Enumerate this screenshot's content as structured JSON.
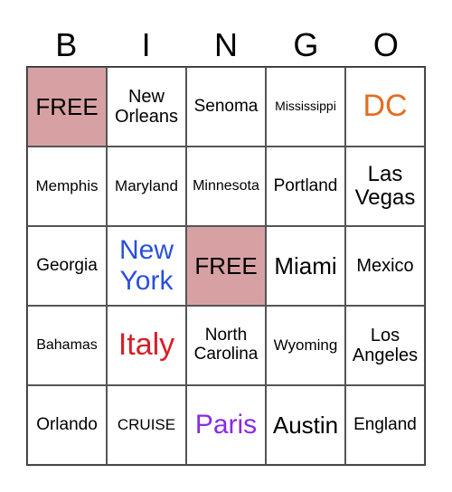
{
  "header": [
    "B",
    "I",
    "N",
    "G",
    "O"
  ],
  "colors": {
    "free_bg": "#d7a1a3",
    "orange": "#e36c1f",
    "blue": "#2b4fdc",
    "red": "#d91e26",
    "purple": "#8a2be2"
  },
  "cells": [
    [
      "FREE",
      "New Orleans",
      "Senoma",
      "Mississippi",
      "DC"
    ],
    [
      "Memphis",
      "Maryland",
      "Minnesota",
      "Portland",
      "Las Vegas"
    ],
    [
      "Georgia",
      "New York",
      "FREE",
      "Miami",
      "Mexico"
    ],
    [
      "Bahamas",
      "Italy",
      "North Carolina",
      "Wyoming",
      "Los Angeles"
    ],
    [
      "Orlando",
      "CRUISE",
      "Paris",
      "Austin",
      "England"
    ]
  ]
}
